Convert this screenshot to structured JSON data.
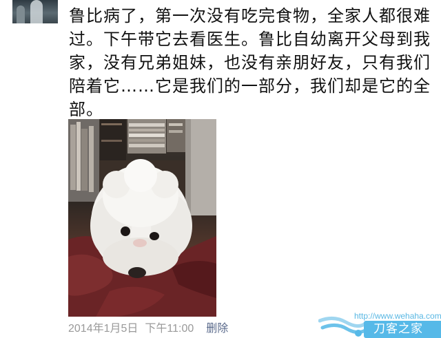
{
  "post": {
    "text": "鲁比病了，第一次没有吃完食物，全家人都很难过。下午带它去看医生。鲁比自幼离开父母到我家，没有兄弟姐妹，也没有亲朋好友，只有我们陪着它……它是我们的一部分，我们却是它的全部。",
    "date": "2014年1月5日",
    "time": "下午11:00",
    "delete_label": "删除"
  },
  "watermark": {
    "url": "http://www.wehaha.com",
    "site_name": "刀客之家"
  },
  "icons": {
    "avatar": "avatar",
    "photo": "white-poodle-photo",
    "watermark_logo": "swirl-logo-icon"
  },
  "colors": {
    "text": "#111111",
    "meta": "#999999",
    "delete_link": "#5b6b8c",
    "watermark_blue": "#56b9e8"
  }
}
